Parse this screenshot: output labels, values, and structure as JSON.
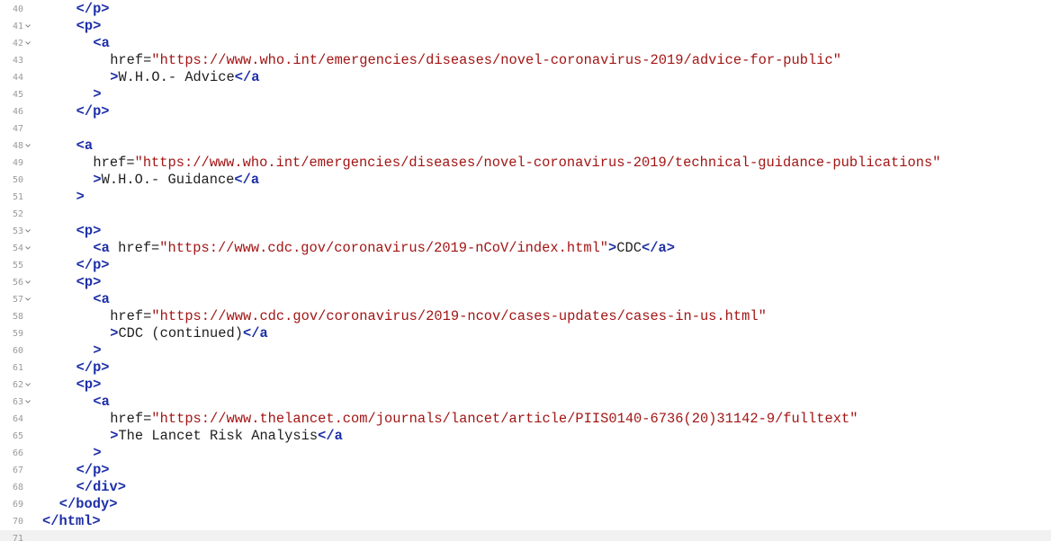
{
  "editor": {
    "lines": [
      {
        "num": "40",
        "fold": false,
        "indent": 2,
        "parts": [
          {
            "t": "tag",
            "v": "</p>"
          }
        ]
      },
      {
        "num": "41",
        "fold": true,
        "indent": 2,
        "parts": [
          {
            "t": "tag",
            "v": "<p>"
          }
        ]
      },
      {
        "num": "42",
        "fold": true,
        "indent": 3,
        "parts": [
          {
            "t": "tag",
            "v": "<a"
          }
        ]
      },
      {
        "num": "43",
        "fold": false,
        "indent": 4,
        "parts": [
          {
            "t": "attr",
            "v": "href="
          },
          {
            "t": "str",
            "v": "\"https://www.who.int/emergencies/diseases/novel-coronavirus-2019/advice-for-public\""
          }
        ]
      },
      {
        "num": "44",
        "fold": false,
        "indent": 4,
        "parts": [
          {
            "t": "tag",
            "v": ">"
          },
          {
            "t": "txt",
            "v": "W.H.O.- Advice"
          },
          {
            "t": "tag",
            "v": "</a"
          }
        ]
      },
      {
        "num": "45",
        "fold": false,
        "indent": 3,
        "parts": [
          {
            "t": "tag",
            "v": ">"
          }
        ]
      },
      {
        "num": "46",
        "fold": false,
        "indent": 2,
        "parts": [
          {
            "t": "tag",
            "v": "</p>"
          }
        ]
      },
      {
        "num": "47",
        "fold": false,
        "indent": 0,
        "parts": []
      },
      {
        "num": "48",
        "fold": true,
        "indent": 2,
        "parts": [
          {
            "t": "tag",
            "v": "<a"
          }
        ]
      },
      {
        "num": "49",
        "fold": false,
        "indent": 3,
        "parts": [
          {
            "t": "attr",
            "v": "href="
          },
          {
            "t": "str",
            "v": "\"https://www.who.int/emergencies/diseases/novel-coronavirus-2019/technical-guidance-publications\""
          }
        ]
      },
      {
        "num": "50",
        "fold": false,
        "indent": 3,
        "parts": [
          {
            "t": "tag",
            "v": ">"
          },
          {
            "t": "txt",
            "v": "W.H.O.- Guidance"
          },
          {
            "t": "tag",
            "v": "</a"
          }
        ]
      },
      {
        "num": "51",
        "fold": false,
        "indent": 2,
        "parts": [
          {
            "t": "tag",
            "v": ">"
          }
        ]
      },
      {
        "num": "52",
        "fold": false,
        "indent": 0,
        "parts": []
      },
      {
        "num": "53",
        "fold": true,
        "indent": 2,
        "parts": [
          {
            "t": "tag",
            "v": "<p>"
          }
        ]
      },
      {
        "num": "54",
        "fold": true,
        "indent": 3,
        "parts": [
          {
            "t": "tag",
            "v": "<a"
          },
          {
            "t": "attr",
            "v": " href="
          },
          {
            "t": "str",
            "v": "\"https://www.cdc.gov/coronavirus/2019-nCoV/index.html\""
          },
          {
            "t": "tag",
            "v": ">"
          },
          {
            "t": "txt",
            "v": "CDC"
          },
          {
            "t": "tag",
            "v": "</a>"
          }
        ]
      },
      {
        "num": "55",
        "fold": false,
        "indent": 2,
        "parts": [
          {
            "t": "tag",
            "v": "</p>"
          }
        ]
      },
      {
        "num": "56",
        "fold": true,
        "indent": 2,
        "parts": [
          {
            "t": "tag",
            "v": "<p>"
          }
        ]
      },
      {
        "num": "57",
        "fold": true,
        "indent": 3,
        "parts": [
          {
            "t": "tag",
            "v": "<a"
          }
        ]
      },
      {
        "num": "58",
        "fold": false,
        "indent": 4,
        "parts": [
          {
            "t": "attr",
            "v": "href="
          },
          {
            "t": "str",
            "v": "\"https://www.cdc.gov/coronavirus/2019-ncov/cases-updates/cases-in-us.html\""
          }
        ]
      },
      {
        "num": "59",
        "fold": false,
        "indent": 4,
        "parts": [
          {
            "t": "tag",
            "v": ">"
          },
          {
            "t": "txt",
            "v": "CDC (continued)"
          },
          {
            "t": "tag",
            "v": "</a"
          }
        ]
      },
      {
        "num": "60",
        "fold": false,
        "indent": 3,
        "parts": [
          {
            "t": "tag",
            "v": ">"
          }
        ]
      },
      {
        "num": "61",
        "fold": false,
        "indent": 2,
        "parts": [
          {
            "t": "tag",
            "v": "</p>"
          }
        ]
      },
      {
        "num": "62",
        "fold": true,
        "indent": 2,
        "parts": [
          {
            "t": "tag",
            "v": "<p>"
          }
        ]
      },
      {
        "num": "63",
        "fold": true,
        "indent": 3,
        "parts": [
          {
            "t": "tag",
            "v": "<a"
          }
        ]
      },
      {
        "num": "64",
        "fold": false,
        "indent": 4,
        "parts": [
          {
            "t": "attr",
            "v": "href="
          },
          {
            "t": "str",
            "v": "\"https://www.thelancet.com/journals/lancet/article/PIIS0140-6736(20)31142-9/fulltext\""
          }
        ]
      },
      {
        "num": "65",
        "fold": false,
        "indent": 4,
        "parts": [
          {
            "t": "tag",
            "v": ">"
          },
          {
            "t": "txt",
            "v": "The Lancet Risk Analysis"
          },
          {
            "t": "tag",
            "v": "</a"
          }
        ]
      },
      {
        "num": "66",
        "fold": false,
        "indent": 3,
        "parts": [
          {
            "t": "tag",
            "v": ">"
          }
        ]
      },
      {
        "num": "67",
        "fold": false,
        "indent": 2,
        "parts": [
          {
            "t": "tag",
            "v": "</p>"
          }
        ]
      },
      {
        "num": "68",
        "fold": false,
        "indent": 2,
        "parts": [
          {
            "t": "tag",
            "v": "</div>"
          }
        ]
      },
      {
        "num": "69",
        "fold": false,
        "indent": 1,
        "parts": [
          {
            "t": "tag",
            "v": "</body>"
          }
        ]
      },
      {
        "num": "70",
        "fold": false,
        "indent": 0,
        "parts": [
          {
            "t": "tag",
            "v": "</html>"
          }
        ]
      },
      {
        "num": "71",
        "fold": false,
        "indent": 0,
        "parts": [],
        "active": true
      }
    ],
    "fold_icon": "chevron-down-icon",
    "colors": {
      "tag": "#1d2fa8",
      "string": "#a31515",
      "text": "#1f1f1f",
      "line_number": "#9a9a9a",
      "active_line": "#f1f1f1"
    }
  }
}
